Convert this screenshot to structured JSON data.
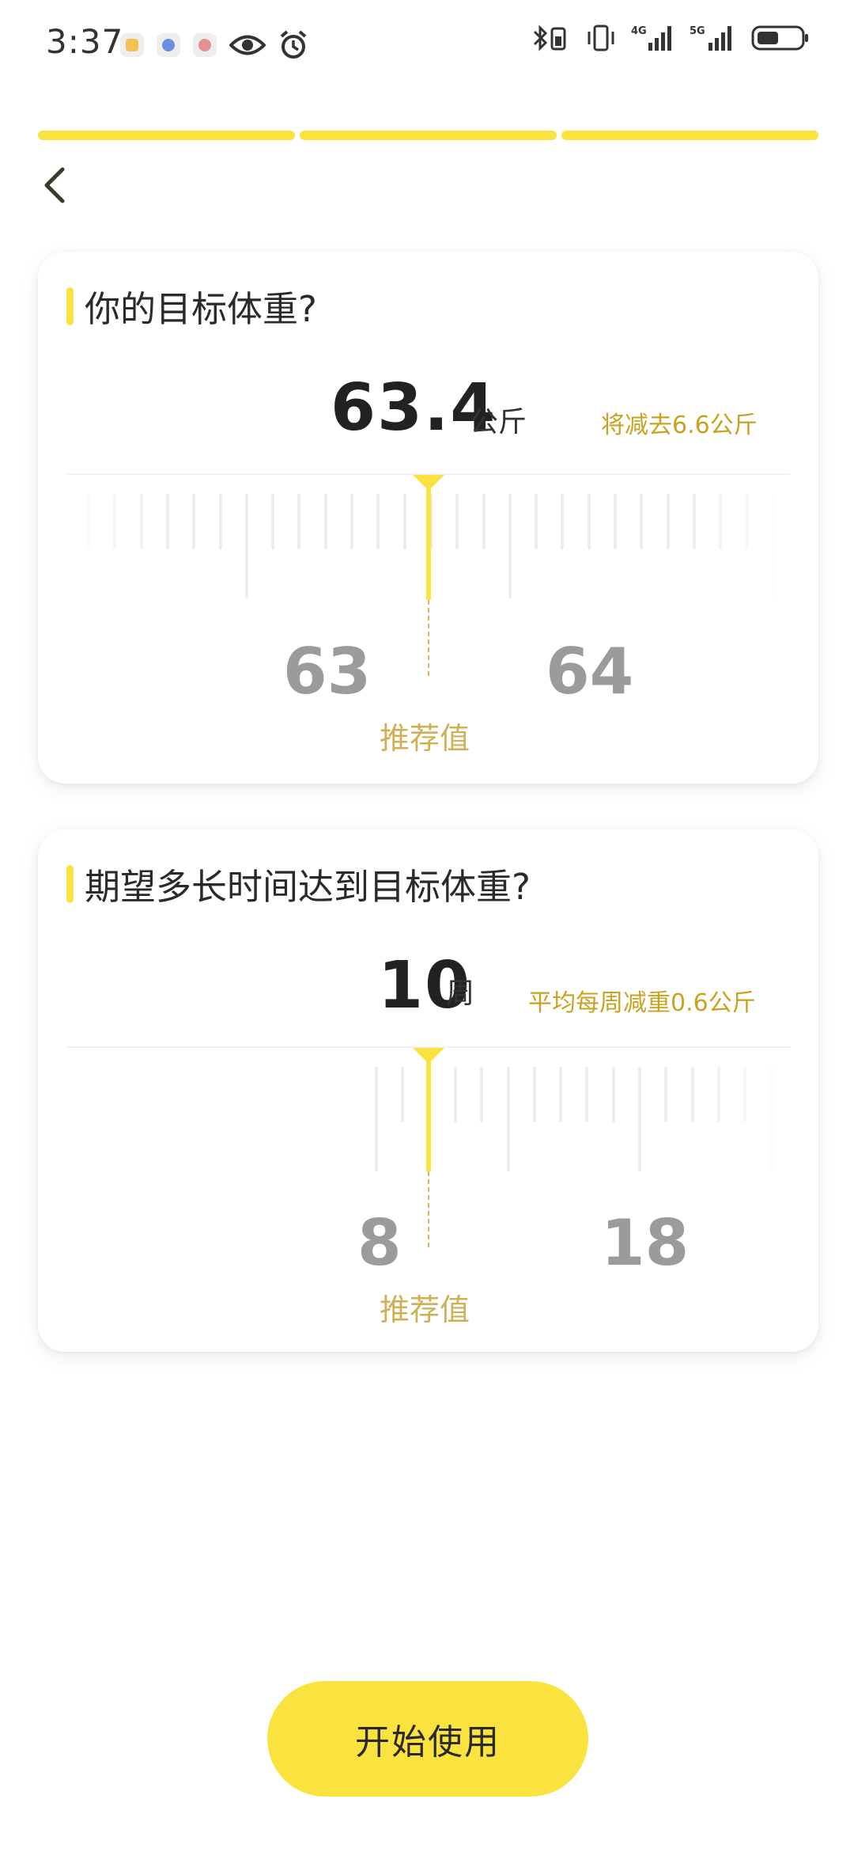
{
  "status_bar": {
    "time": "3:37"
  },
  "progress": {
    "segments": 3,
    "completed": 3
  },
  "weight_card": {
    "title": "你的目标体重?",
    "value": "63.4",
    "unit": "公斤",
    "hint": "将减去6.6公斤",
    "scale_left": "63",
    "scale_right": "64",
    "recommend_label": "推荐值"
  },
  "duration_card": {
    "title": "期望多长时间达到目标体重?",
    "value": "10",
    "unit": "周",
    "hint": "平均每周减重0.6公斤",
    "scale_left": "8",
    "scale_right": "18",
    "recommend_label": "推荐值"
  },
  "start_button": {
    "label": "开始使用"
  },
  "colors": {
    "accent": "#fbe33f",
    "hint": "#c9a31f",
    "recommend": "#cfb054"
  }
}
